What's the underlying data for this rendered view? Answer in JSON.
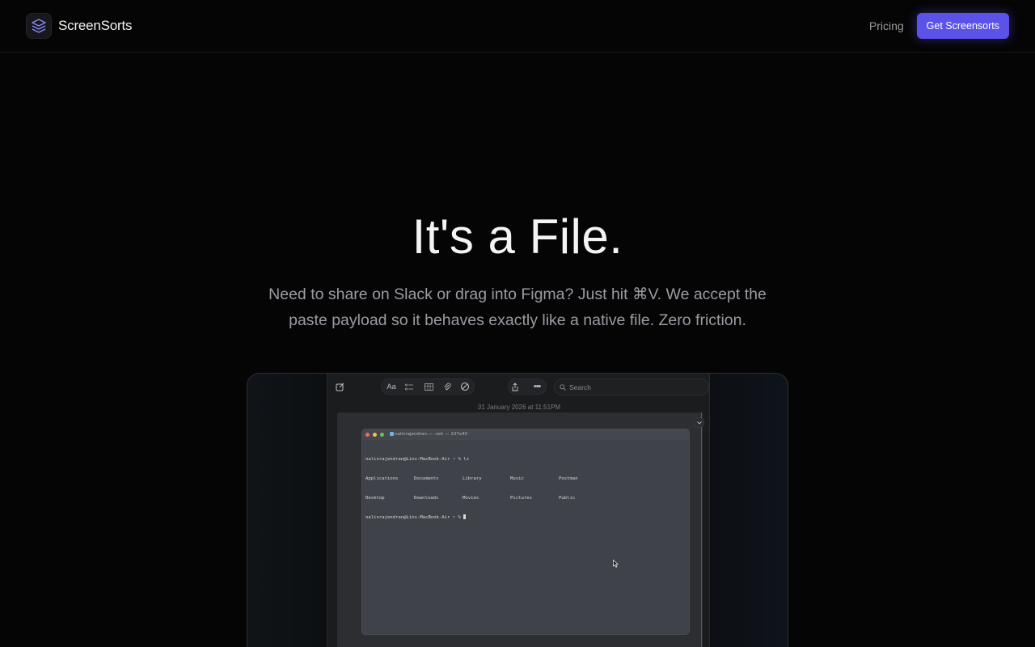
{
  "nav": {
    "brand_name": "ScreenSorts",
    "brand_icon": "layers-icon",
    "pricing_label": "Pricing",
    "cta_label": "Get Screensorts",
    "accent_color": "#5b52e8"
  },
  "hero": {
    "title": "It's a File.",
    "subtitle": "Need to share on Slack or drag into Figma? Just hit ⌘V. We accept the paste payload so it behaves exactly like a native file. Zero friction."
  },
  "mockup": {
    "toolbar_font_label": "Aa",
    "search_placeholder": "Search",
    "date_text": "31 January 2026 at 11:51PM",
    "terminal": {
      "title": "nalinrajendran — -zsh — 107x40",
      "prompt_line": "nalinrajendran@Lins-MacBook-Air ~ % ls",
      "rows": [
        [
          "Applications",
          "Documents",
          "Library",
          "Music",
          "Postman"
        ],
        [
          "Desktop",
          "Downloads",
          "Movies",
          "Pictures",
          "Public"
        ]
      ],
      "last_prompt": "nalinrajendran@Lins-MacBook-Air ~ % "
    }
  }
}
